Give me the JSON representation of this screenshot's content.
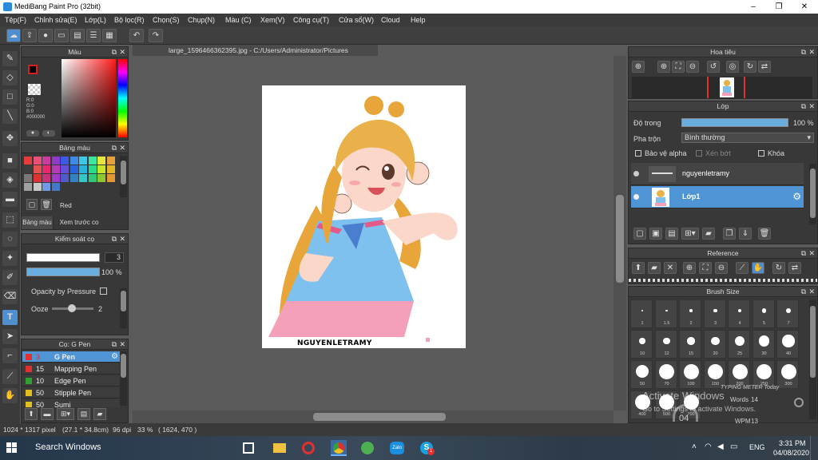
{
  "window": {
    "title": "MediBang Paint Pro (32bit)",
    "minimize_glyph": "–",
    "maximize_glyph": "❐",
    "close_glyph": "✕"
  },
  "menu": [
    "Tệp(F)",
    "Chỉnh sửa(E)",
    "Lớp(L)",
    "Bộ lọc(R)",
    "Chọn(S)",
    "Chụp(N)",
    "Màu (C)",
    "Xem(V)",
    "Công cụ(T)",
    "Cửa sổ(W)",
    "Cloud",
    "Help"
  ],
  "document": {
    "tab_label": "large_1596466362395.jpg - C:/Users/Administrator/Pictures",
    "close_glyph": "✕",
    "artwork_signature": "NGUYENLETRAMY"
  },
  "color_panel": {
    "title": "Màu",
    "r": "R:0",
    "g": "G:0",
    "b": "B:0",
    "hex": "#000000",
    "main_color": "#000000",
    "sub_color": "#d42020"
  },
  "palette_panel": {
    "title": "Bảng màu",
    "selected_name": "Red",
    "tab1": "Bảng màu",
    "tab2": "Xem trước co",
    "swatches": [
      "#e63c3c",
      "#e8507a",
      "#c83ca0",
      "#8c3cc8",
      "#3c5ae6",
      "#3c8ce6",
      "#3cc8e6",
      "#3ce6a0",
      "#e6e63c",
      "#e6a03c",
      "#3c3c3c",
      "#e65050",
      "#e6286e",
      "#b43cb4",
      "#6450dc",
      "#2864dc",
      "#28b4dc",
      "#28dc8c",
      "#c8e628",
      "#e6b428",
      "#787878",
      "#dc3232",
      "#c8327a",
      "#a03cc8",
      "#505ac8",
      "#3282c8",
      "#32c8c8",
      "#32c87a",
      "#8cc832",
      "#e69632",
      "#a0a0a0",
      "#c8c8c8",
      "#6e9ae6",
      "#4678c8"
    ]
  },
  "brush_control": {
    "title": "Kiểm soát cọ",
    "width_value": "3",
    "opacity_value": "100 %",
    "opacity_pressure_label": "Opacity by Pressure",
    "ooze_label": "Ooze",
    "ooze_value": "2"
  },
  "brush_list": {
    "title": "Cọ: G Pen",
    "items": [
      {
        "size": "3",
        "name": "G Pen",
        "color": "#e03030"
      },
      {
        "size": "15",
        "name": "Mapping Pen",
        "color": "#e03030"
      },
      {
        "size": "10",
        "name": "Edge Pen",
        "color": "#30a030"
      },
      {
        "size": "50",
        "name": "Stipple Pen",
        "color": "#e0c020"
      },
      {
        "size": "50",
        "name": "Sumi",
        "color": "#e0c020"
      }
    ]
  },
  "navigator": {
    "title": "Hoa tiêu"
  },
  "layers": {
    "title": "Lớp",
    "opacity_label": "Độ trong",
    "opacity_value": "100 %",
    "blend_label": "Pha trộn",
    "blend_value": "Bình thường",
    "protect_alpha": "Bảo vệ alpha",
    "clipping": "Xén bớt",
    "lock": "Khóa",
    "items": [
      {
        "name": "nguyenletramy",
        "selected": false
      },
      {
        "name": "Lớp1",
        "selected": true
      }
    ]
  },
  "reference": {
    "title": "Reference"
  },
  "brush_size": {
    "title": "Brush Size",
    "labels": [
      "1",
      "1.5",
      "2",
      "3",
      "4",
      "5",
      "7",
      "10",
      "12",
      "15",
      "20",
      "25",
      "30",
      "40",
      "50",
      "70",
      "100",
      "150",
      "200",
      "250",
      "300",
      "400",
      "500",
      "700"
    ]
  },
  "status_bar": {
    "dimensions": "1024 * 1317 pixel",
    "physical": "(27.1 * 34.8cm)",
    "dpi": "96 dpi",
    "zoom": "33 %",
    "cursor": "( 1624, 470 )"
  },
  "watermark": {
    "line1": "Activate Windows",
    "line2": "Go to Settings to activate Windows.",
    "typing_title": "TYPING METER Today",
    "words_label": "Words",
    "words_value": "14",
    "wpm_label": "WPM",
    "wpm_value": "13",
    "waiting": "(waiting...)",
    "gauge_value": "04",
    "gauge_unit": "WPM"
  },
  "taskbar": {
    "search_placeholder": "Search Windows",
    "language": "ENG",
    "time": "3:31 PM",
    "date": "04/08/2020",
    "badge_count": "1"
  }
}
